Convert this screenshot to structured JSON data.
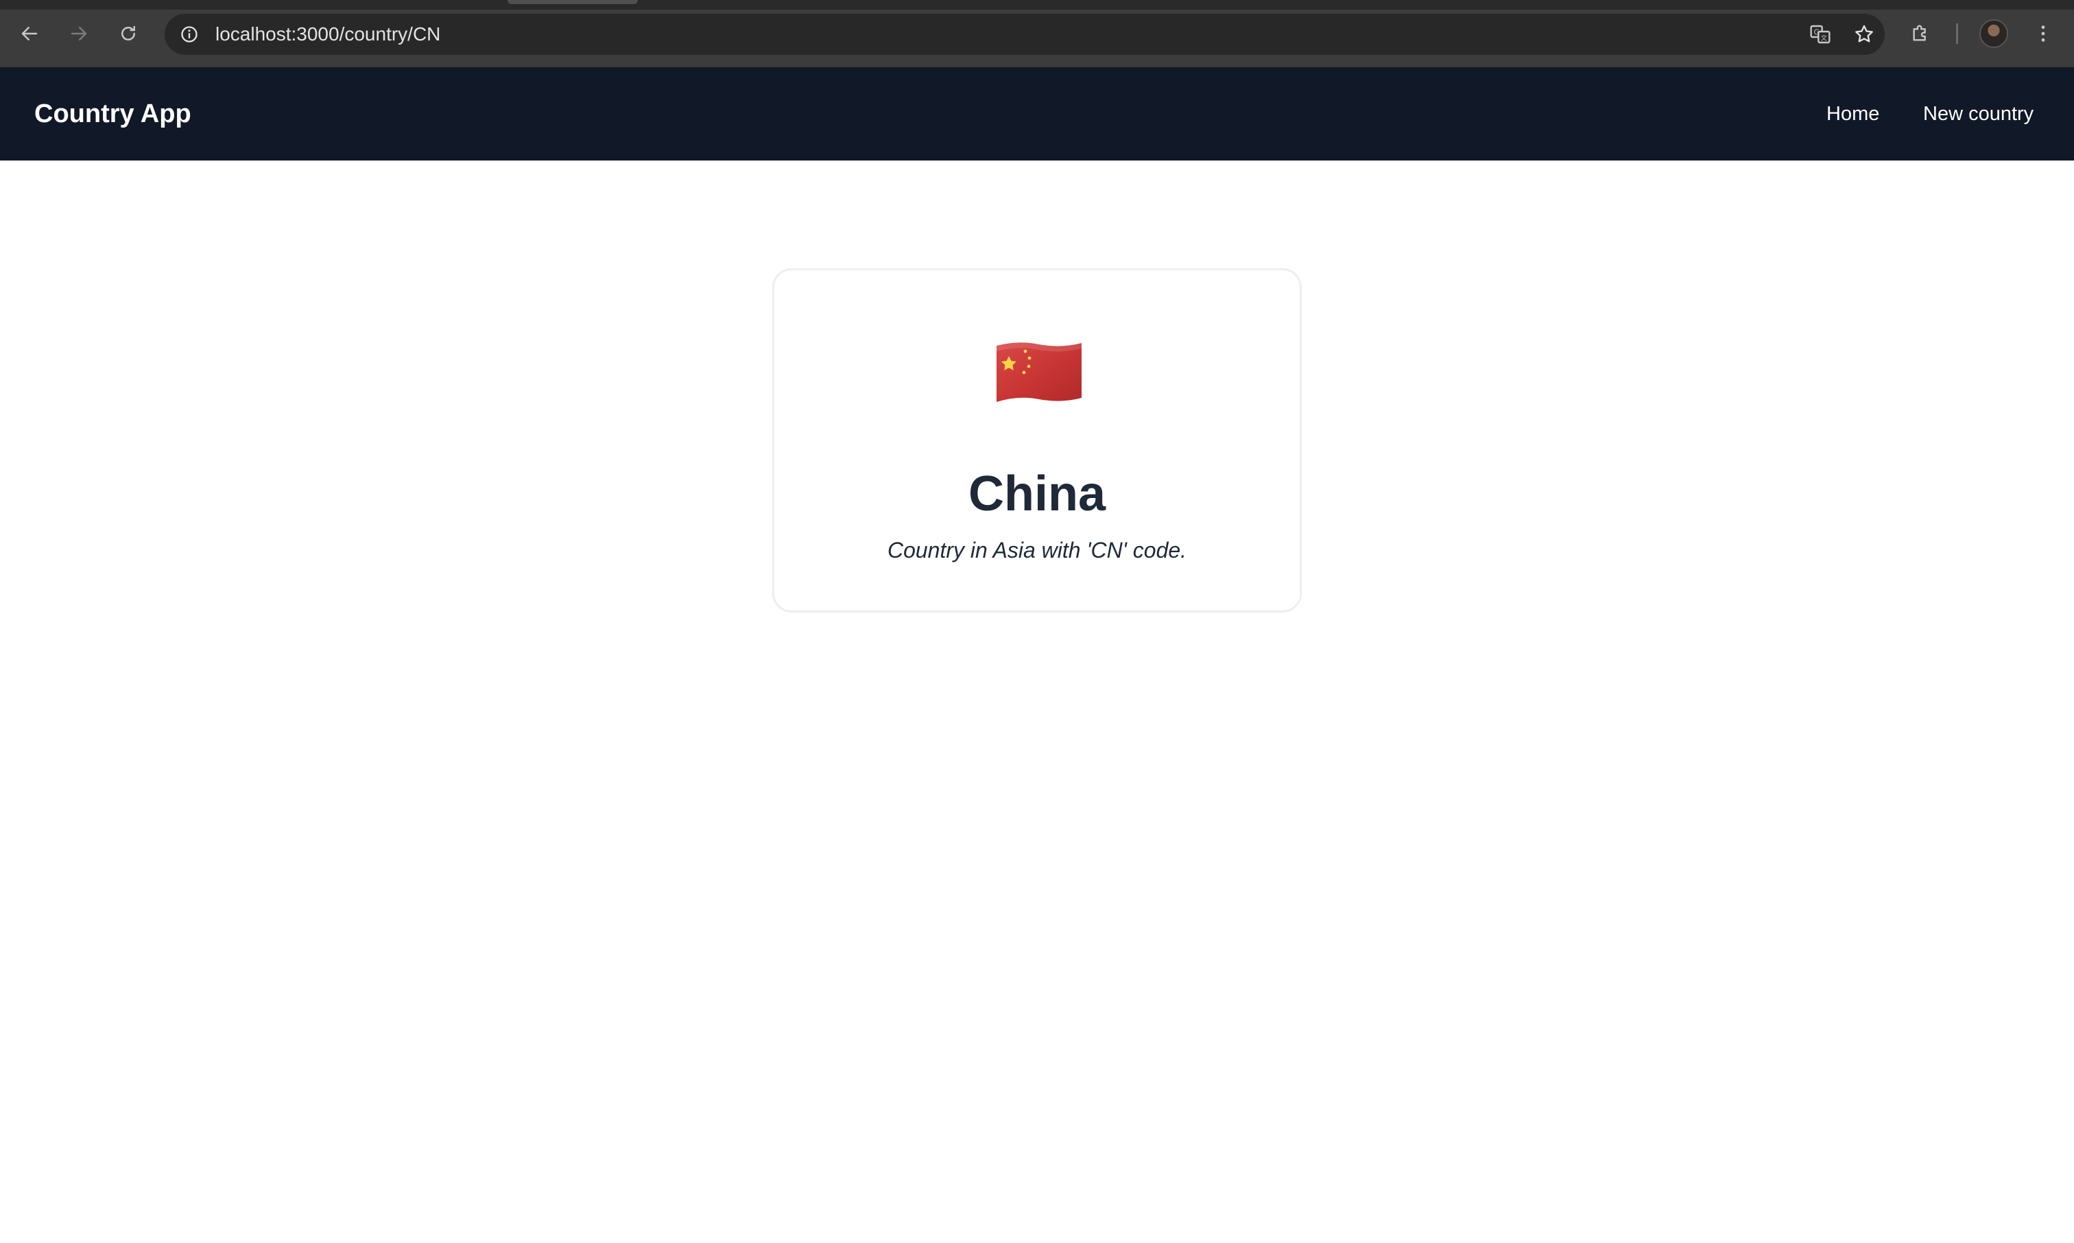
{
  "browser": {
    "url": "localhost:3000/country/CN",
    "icons": {
      "back": "back-arrow-icon",
      "forward": "forward-arrow-icon",
      "reload": "reload-icon",
      "site_info": "site-info-icon",
      "translate": "translate-icon",
      "bookmark": "star-icon",
      "extensions": "puzzle-icon",
      "menu": "kebab-menu-icon"
    }
  },
  "navbar": {
    "brand": "Country App",
    "links": [
      {
        "label": "Home"
      },
      {
        "label": "New country"
      }
    ]
  },
  "country": {
    "flag_icon": "china-flag-icon",
    "name": "China",
    "description": "Country in Asia with 'CN' code."
  },
  "colors": {
    "navbar_bg": "#111827",
    "text_dark": "#1f2937",
    "flag_red": "#d23a3a",
    "flag_star": "#f7d548"
  }
}
